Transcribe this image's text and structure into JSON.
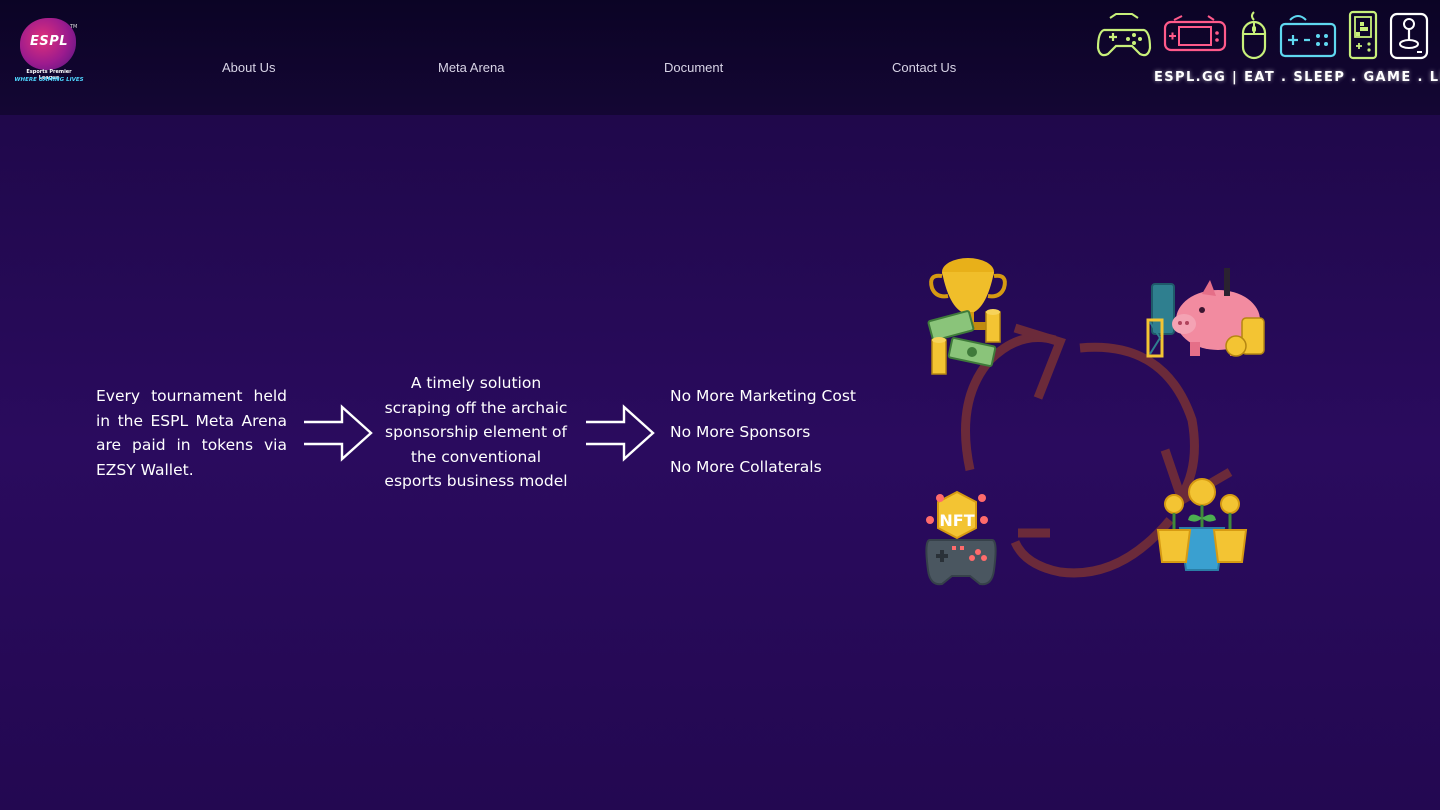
{
  "logo": {
    "title": "ESPL",
    "tm": "TM",
    "subtitle": "Esports Premier League",
    "tagline": "WHERE GAMING LIVES"
  },
  "nav": {
    "items": [
      "About Us",
      "Meta Arena",
      "Document",
      "Contact Us"
    ]
  },
  "header": {
    "tagline": "ESPL.GG | EAT . SLEEP . GAME . LIVE",
    "icons": [
      "gamepad-icon",
      "handheld-console-icon",
      "mouse-icon",
      "retro-controller-icon",
      "tetris-device-icon",
      "joystick-icon"
    ]
  },
  "flow": {
    "step1": "Every tournament held in the ESPL Meta Arena are paid in tokens via EZSY Wallet.",
    "step2": "A timely solution scraping off the archaic sponsorship element of the conventional esports business model",
    "benefits": [
      "No More Marketing Cost",
      "No More Sponsors",
      "No More Collaterals"
    ]
  },
  "cycle": {
    "nft_label": "NFT",
    "icons": [
      "trophy-money-icon",
      "piggy-bank-icon",
      "nft-gamepad-icon",
      "crypto-plant-icon"
    ]
  },
  "colors": {
    "background": "#240a52",
    "header": "#0b0425",
    "cycle_arrow": "#6b2a3a",
    "neon_green": "#c8f07a",
    "neon_pink": "#ff5a8a",
    "neon_cyan": "#5fd8f0"
  }
}
